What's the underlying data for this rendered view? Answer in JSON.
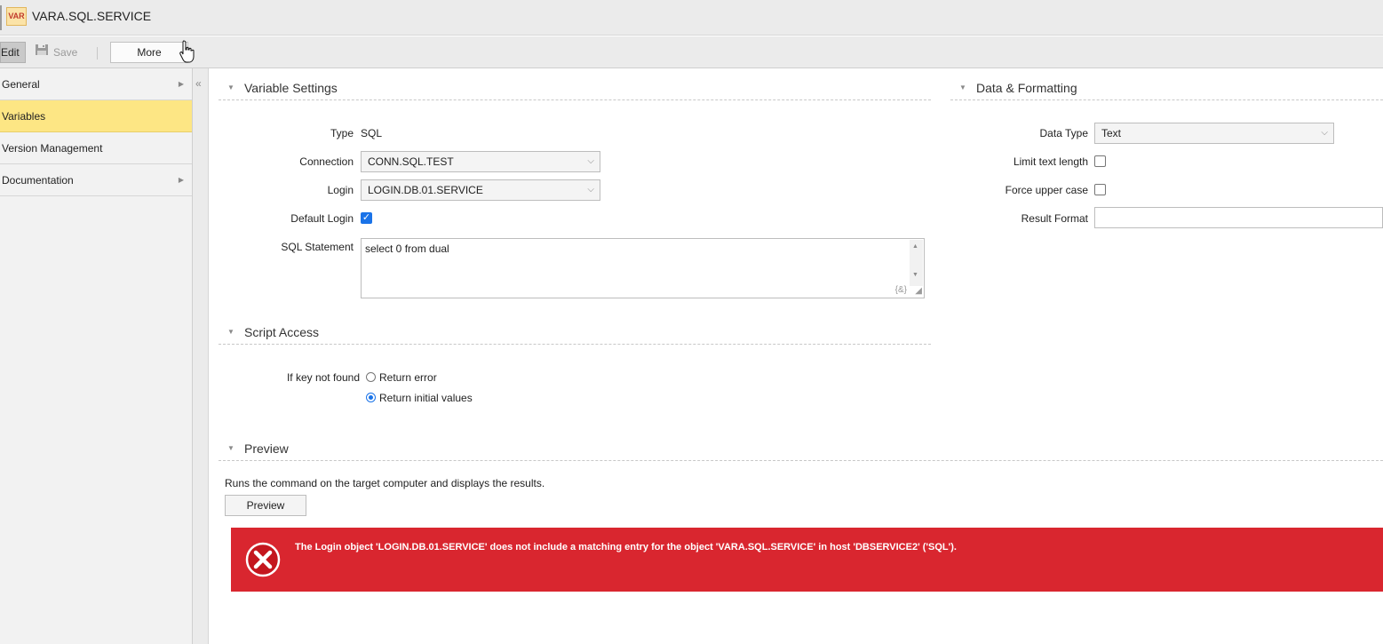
{
  "window": {
    "icon_label": "VAR",
    "title": "VARA.SQL.SERVICE"
  },
  "toolbar": {
    "edit_label": "Edit",
    "save_label": "Save",
    "more_label": "More"
  },
  "sidebar": {
    "items": [
      {
        "label": "General",
        "has_arrow": true
      },
      {
        "label": "Variables",
        "active": true
      },
      {
        "label": "Version Management"
      },
      {
        "label": "Documentation",
        "has_arrow": true
      }
    ],
    "collapse_glyph": "«"
  },
  "variable_settings": {
    "title": "Variable Settings",
    "type_label": "Type",
    "type_value": "SQL",
    "connection_label": "Connection",
    "connection_value": "CONN.SQL.TEST",
    "login_label": "Login",
    "login_value": "LOGIN.DB.01.SERVICE",
    "default_login_label": "Default Login",
    "default_login_checked": true,
    "sql_label": "SQL Statement",
    "sql_value": "select 0 from dual",
    "sql_var_glyph": "{&}"
  },
  "data_formatting": {
    "title": "Data & Formatting",
    "data_type_label": "Data Type",
    "data_type_value": "Text",
    "limit_label": "Limit text length",
    "limit_checked": false,
    "upper_label": "Force upper case",
    "upper_checked": false,
    "result_format_label": "Result Format",
    "result_format_value": ""
  },
  "script_access": {
    "title": "Script Access",
    "label": "If key not found",
    "options": [
      {
        "label": "Return error",
        "selected": false
      },
      {
        "label": "Return initial values",
        "selected": true
      }
    ]
  },
  "preview": {
    "title": "Preview",
    "description": "Runs the command on the target computer and displays the results.",
    "button_label": "Preview"
  },
  "error": {
    "message": "The Login object 'LOGIN.DB.01.SERVICE' does not include a matching entry for the object 'VARA.SQL.SERVICE' in host 'DBSERVICE2' ('SQL').",
    "color": "#d9262f"
  },
  "colors": {
    "active_nav": "#fde684",
    "accent": "#1a73e8"
  }
}
